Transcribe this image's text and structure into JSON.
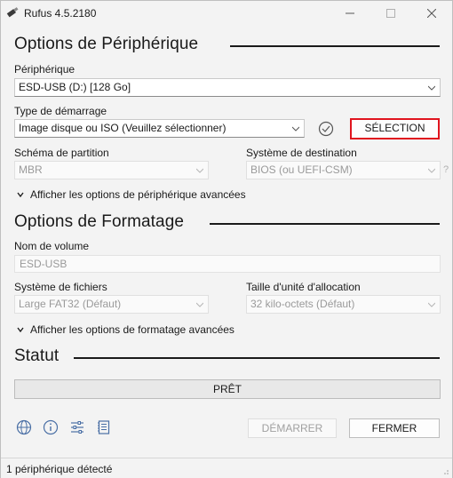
{
  "window": {
    "title": "Rufus 4.5.2180",
    "icon": "usb-drive-icon"
  },
  "device_section": {
    "title": "Options de Périphérique",
    "device_label": "Périphérique",
    "device_value": "ESD-USB (D:) [128 Go]",
    "boot_type_label": "Type de démarrage",
    "boot_type_value": "Image disque ou ISO (Veuillez sélectionner)",
    "select_button": "SÉLECTION",
    "partition_label": "Schéma de partition",
    "partition_value": "MBR",
    "target_label": "Système de destination",
    "target_value": "BIOS (ou UEFI-CSM)",
    "target_help": "?",
    "advanced_toggle": "Afficher les options de périphérique avancées"
  },
  "format_section": {
    "title": "Options de Formatage",
    "volume_label": "Nom de volume",
    "volume_value": "ESD-USB",
    "fs_label": "Système de fichiers",
    "fs_value": "Large FAT32 (Défaut)",
    "cluster_label": "Taille d'unité d'allocation",
    "cluster_value": "32 kilo-octets (Défaut)",
    "advanced_toggle": "Afficher les options de formatage avancées"
  },
  "status_section": {
    "title": "Statut",
    "status_text": "PRÊT",
    "progress": 0
  },
  "actions": {
    "start_button": "DÉMARRER",
    "close_button": "FERMER"
  },
  "footer": {
    "status_text": "1 périphérique détecté"
  },
  "colors": {
    "highlight_border": "#e0141e",
    "window_bg": "#f3f3f3"
  }
}
